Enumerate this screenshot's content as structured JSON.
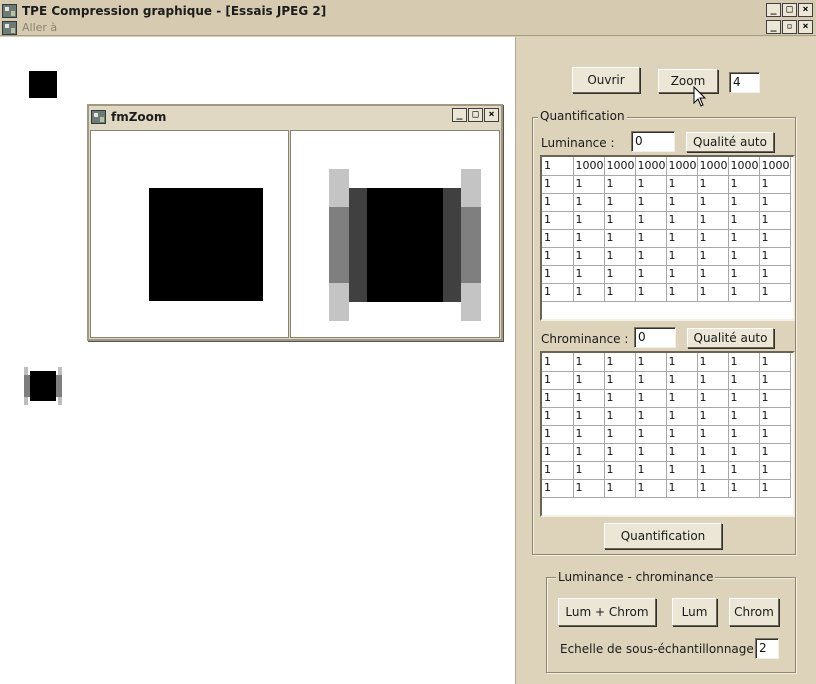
{
  "window": {
    "title": "TPE Compression graphique - [Essais JPEG 2]",
    "menu_label": "Aller à",
    "title_buttons": {
      "minimize": "_",
      "maximize": "□",
      "restore": "▫",
      "close": "×"
    }
  },
  "zoom_window": {
    "title": "fmZoom"
  },
  "panel": {
    "open_button": "Ouvrir",
    "zoom_button": "Zoom",
    "zoom_value": "4",
    "quantification_group": "Quantification",
    "luminance_label": "Luminance :",
    "luminance_value": "0",
    "luminance_auto_button": "Qualité auto",
    "luminance_matrix": [
      [
        "1",
        "1000",
        "1000",
        "1000",
        "1000",
        "1000",
        "1000",
        "1000"
      ],
      [
        "1",
        "1",
        "1",
        "1",
        "1",
        "1",
        "1",
        "1"
      ],
      [
        "1",
        "1",
        "1",
        "1",
        "1",
        "1",
        "1",
        "1"
      ],
      [
        "1",
        "1",
        "1",
        "1",
        "1",
        "1",
        "1",
        "1"
      ],
      [
        "1",
        "1",
        "1",
        "1",
        "1",
        "1",
        "1",
        "1"
      ],
      [
        "1",
        "1",
        "1",
        "1",
        "1",
        "1",
        "1",
        "1"
      ],
      [
        "1",
        "1",
        "1",
        "1",
        "1",
        "1",
        "1",
        "1"
      ],
      [
        "1",
        "1",
        "1",
        "1",
        "1",
        "1",
        "1",
        "1"
      ]
    ],
    "chrominance_label": "Chrominance :",
    "chrominance_value": "0",
    "chrominance_auto_button": "Qualité auto",
    "chrominance_matrix": [
      [
        "1",
        "1",
        "1",
        "1",
        "1",
        "1",
        "1",
        "1"
      ],
      [
        "1",
        "1",
        "1",
        "1",
        "1",
        "1",
        "1",
        "1"
      ],
      [
        "1",
        "1",
        "1",
        "1",
        "1",
        "1",
        "1",
        "1"
      ],
      [
        "1",
        "1",
        "1",
        "1",
        "1",
        "1",
        "1",
        "1"
      ],
      [
        "1",
        "1",
        "1",
        "1",
        "1",
        "1",
        "1",
        "1"
      ],
      [
        "1",
        "1",
        "1",
        "1",
        "1",
        "1",
        "1",
        "1"
      ],
      [
        "1",
        "1",
        "1",
        "1",
        "1",
        "1",
        "1",
        "1"
      ],
      [
        "1",
        "1",
        "1",
        "1",
        "1",
        "1",
        "1",
        "1"
      ]
    ],
    "quantification_button": "Quantification",
    "lumchrom_group": "Luminance - chrominance",
    "lum_chrom_button": "Lum + Chrom",
    "lum_button": "Lum",
    "chrom_button": "Chrom",
    "subsampling_label": "Echelle de sous-échantillonnage :",
    "subsampling_value": "2"
  }
}
